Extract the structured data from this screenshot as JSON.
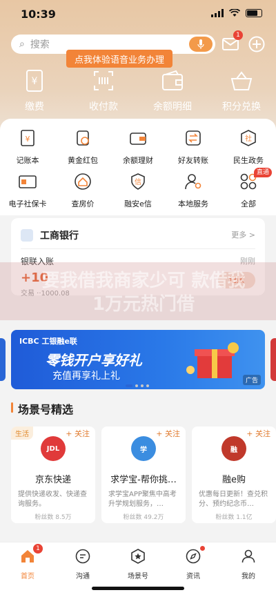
{
  "status": {
    "time": "10:39"
  },
  "search": {
    "placeholder": "搜索"
  },
  "header": {
    "mail_badge": "1",
    "tooltip": "点我体验语音业务办理"
  },
  "quick_actions": [
    {
      "label": "缴费",
      "icon": "bill-pay-icon"
    },
    {
      "label": "收付款",
      "icon": "scan-pay-icon"
    },
    {
      "label": "余额明细",
      "icon": "wallet-icon"
    },
    {
      "label": "积分兑换",
      "icon": "basket-icon"
    }
  ],
  "services": [
    [
      {
        "label": "记账本",
        "icon": "ledger-icon"
      },
      {
        "label": "黄金红包",
        "icon": "gold-packet-icon"
      },
      {
        "label": "余额理财",
        "icon": "wallet-finance-icon"
      },
      {
        "label": "好友转账",
        "icon": "transfer-icon"
      },
      {
        "label": "民生政务",
        "icon": "government-icon"
      }
    ],
    [
      {
        "label": "电子社保卡",
        "icon": "social-card-icon"
      },
      {
        "label": "查房价",
        "icon": "house-price-icon"
      },
      {
        "label": "融安e信",
        "icon": "shield-credit-icon"
      },
      {
        "label": "本地服务",
        "icon": "local-service-icon"
      },
      {
        "label": "全部",
        "icon": "all-apps-icon",
        "badge": "直通"
      }
    ]
  ],
  "bank_card": {
    "name": "工商银行",
    "more": "更多 >",
    "unionpay": "银联入账",
    "time": "刚刚",
    "amount": "+10",
    "detail": "记账",
    "txline": "交易              ··1000.08"
  },
  "watermark": "要我借我商家少可 款借我1万元热门借",
  "banner": {
    "brand": "ICBC 工银融e联",
    "title": "零钱开户享好礼",
    "subtitle": "充值再享礼上礼",
    "ad": "广告"
  },
  "section": {
    "title": "场景号精选"
  },
  "scene_cards": [
    {
      "tag": "生活",
      "follow": "+ 关注",
      "logo": "JDL",
      "logo_color": "#e03a3a",
      "name": "京东快递",
      "desc": "提供快递收发、快递查询服务。",
      "fans": "粉丝数 8.5万"
    },
    {
      "tag": "",
      "follow": "+ 关注",
      "logo": "学",
      "logo_color": "#3b8de0",
      "name": "求学宝-帮你挑…",
      "desc": "求学宝APP聚焦中高考升学规划服务，…",
      "fans": "粉丝数 49.2万"
    },
    {
      "tag": "",
      "follow": "+ 关注",
      "logo": "融",
      "logo_color": "#c0392b",
      "name": "融e购",
      "desc": "优惠每日更新！查兑积分、预约纪念币…",
      "fans": "粉丝数 1.1亿"
    }
  ],
  "tabs": [
    {
      "label": "首页",
      "badge": "1"
    },
    {
      "label": "沟通"
    },
    {
      "label": "场景号"
    },
    {
      "label": "资讯"
    },
    {
      "label": "我的"
    }
  ],
  "colors": {
    "accent": "#f28438",
    "brand_red": "#e94335",
    "banner_blue": "#2a66d6"
  }
}
